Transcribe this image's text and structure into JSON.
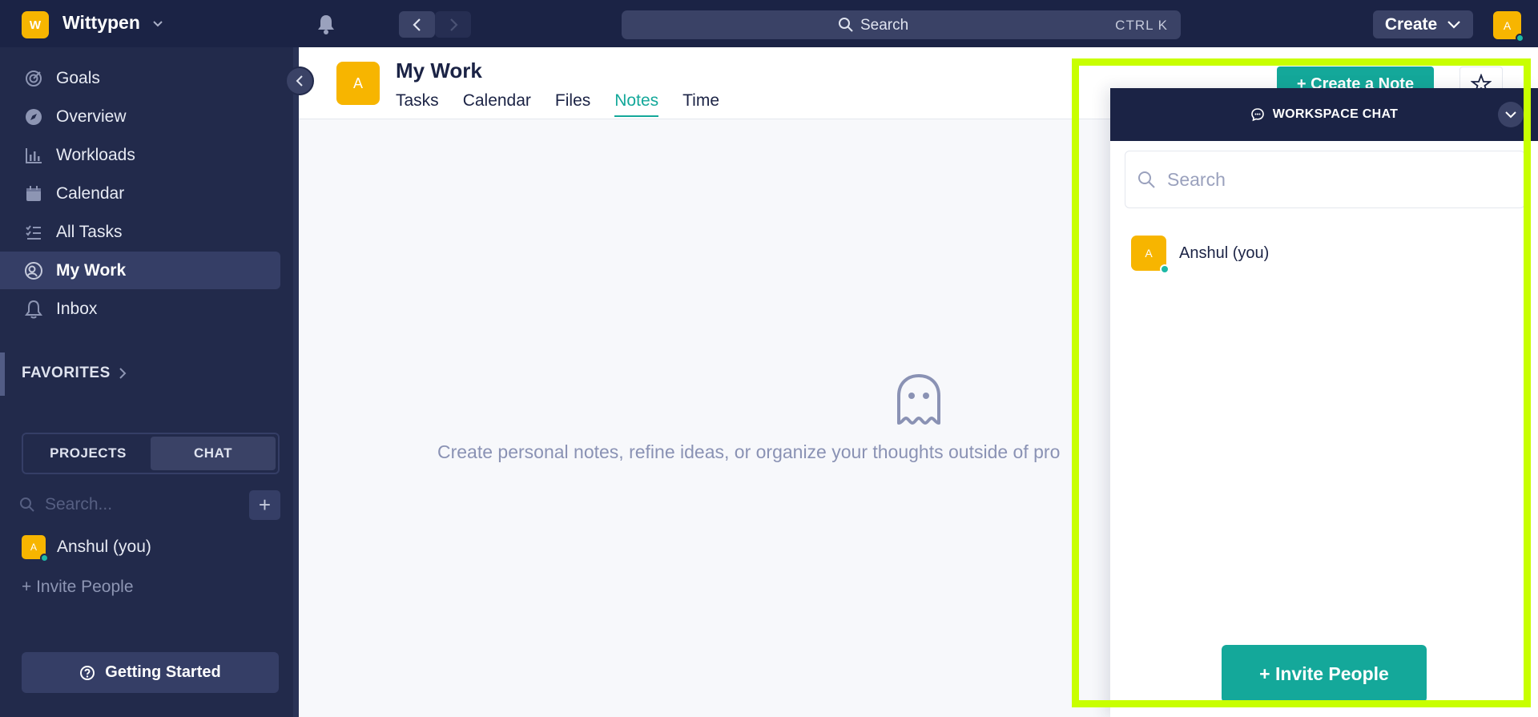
{
  "workspace": {
    "logo_letter": "W",
    "name": "Wittypen"
  },
  "topbar": {
    "search_label": "Search",
    "search_shortcut": "CTRL K",
    "create_label": "Create",
    "user_initial": "A"
  },
  "sidebar": {
    "items": [
      {
        "label": "Goals",
        "icon": "goals-icon"
      },
      {
        "label": "Overview",
        "icon": "compass-icon"
      },
      {
        "label": "Workloads",
        "icon": "bar-chart-icon"
      },
      {
        "label": "Calendar",
        "icon": "calendar-icon"
      },
      {
        "label": "All Tasks",
        "icon": "checklist-icon"
      },
      {
        "label": "My Work",
        "icon": "my-work-icon",
        "active": true
      },
      {
        "label": "Inbox",
        "icon": "bell-icon"
      }
    ],
    "favorites_label": "FAVORITES",
    "segment": {
      "projects": "PROJECTS",
      "chat": "CHAT"
    },
    "search_placeholder": "Search...",
    "user": {
      "initial": "A",
      "name": "Anshul (you)"
    },
    "invite_label": "+ Invite People",
    "getting_started": "Getting Started"
  },
  "page": {
    "avatar_initial": "A",
    "title": "My Work",
    "tabs": [
      "Tasks",
      "Calendar",
      "Files",
      "Notes",
      "Time"
    ],
    "active_tab": "Notes",
    "create_note_label": "+ Create a Note",
    "empty_text": "Create personal notes, refine ideas, or organize your thoughts outside of pro"
  },
  "chat": {
    "title": "WORKSPACE CHAT",
    "search_placeholder": "Search",
    "user": {
      "initial": "A",
      "name": "Anshul (you)"
    },
    "invite_label": "+ Invite People"
  },
  "colors": {
    "navy": "#1b2345",
    "sidebar": "#222a4b",
    "accent": "#14a89a",
    "avatar": "#f7b500",
    "highlight": "#c8ff00"
  }
}
